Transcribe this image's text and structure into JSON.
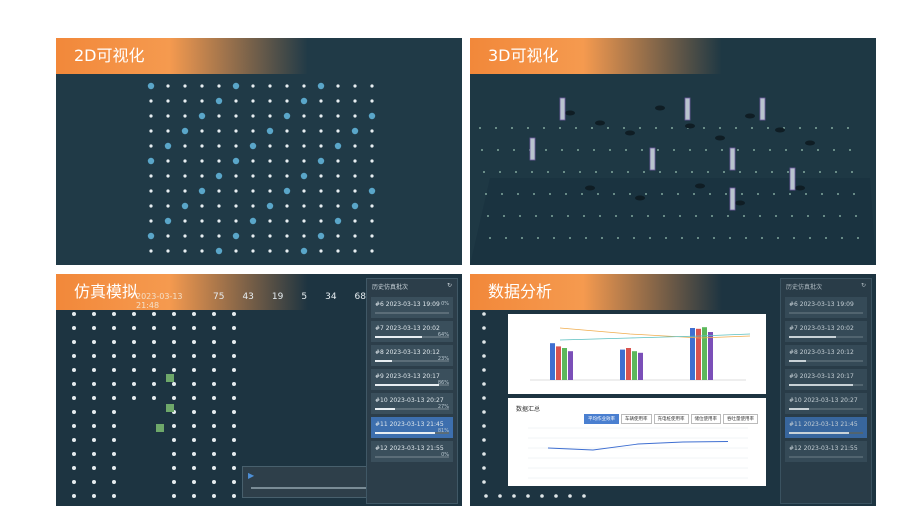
{
  "panels": {
    "p2d": {
      "title": "2D可视化"
    },
    "p3d": {
      "title": "3D可视化"
    },
    "sim": {
      "title": "仿真模拟",
      "header_time": "2023-03-13 21:48",
      "stats": [
        "75",
        "43",
        "19",
        "5",
        "34",
        "68"
      ],
      "side_title": "历史仿真批次",
      "items": [
        {
          "label": "#6  2023-03-13 19:09",
          "pct": "0%"
        },
        {
          "label": "#7  2023-03-13 20:02",
          "pct": "64%"
        },
        {
          "label": "#8  2023-03-13 20:12",
          "pct": "23%"
        },
        {
          "label": "#9  2023-03-13 20:17",
          "pct": "86%"
        },
        {
          "label": "#10  2023-03-13 20:27",
          "pct": "27%"
        },
        {
          "label": "#11  2023-03-13 21:45",
          "pct": "81%"
        },
        {
          "label": "#12  2023-03-13 21:55",
          "pct": "0%"
        }
      ]
    },
    "data": {
      "title": "数据分析",
      "side_title": "历史仿真批次",
      "items": [
        {
          "label": "#6  2023-03-13 19:09"
        },
        {
          "label": "#7  2023-03-13 20:02"
        },
        {
          "label": "#8  2023-03-13 20:12"
        },
        {
          "label": "#9  2023-03-13 20:17"
        },
        {
          "label": "#10  2023-03-13 20:27"
        },
        {
          "label": "#11  2023-03-13 21:45"
        },
        {
          "label": "#12  2023-03-13 21:55"
        }
      ],
      "card_title": "数据汇总",
      "tabs": [
        "平均作业效率",
        "车辆使用率",
        "充电桩使用率",
        "储位使用率",
        "吞吐量使用率"
      ]
    }
  },
  "chart_data": [
    {
      "type": "bar",
      "categories": [
        "分类1",
        "分类2",
        "分类3"
      ],
      "series": [
        {
          "name": "",
          "values": [
            46,
            38,
            65
          ]
        },
        {
          "name": "",
          "values": [
            42,
            40,
            64
          ]
        },
        {
          "name": "",
          "values": [
            40,
            36,
            66
          ]
        },
        {
          "name": "",
          "values": [
            36,
            34,
            60
          ]
        }
      ],
      "ylim": [
        0,
        70
      ]
    },
    {
      "type": "line",
      "x": [
        1,
        2,
        3,
        4,
        5
      ],
      "series": [
        {
          "name": "",
          "values": [
            60,
            56,
            68,
            72,
            73
          ]
        }
      ],
      "ylim": [
        0,
        100
      ]
    }
  ],
  "colors": {
    "accent": "#f2883a",
    "scene_bg": "#1b3340",
    "highlight": "#3d6fae"
  }
}
